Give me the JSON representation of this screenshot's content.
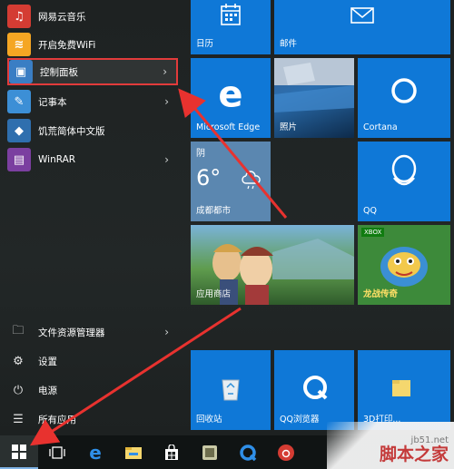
{
  "apps": [
    {
      "name": "网易云音乐",
      "icon": "netease-music-icon",
      "color": "#d43c33",
      "glyph": "♫"
    },
    {
      "name": "开启免费WiFi",
      "icon": "free-wifi-icon",
      "color": "#f5a623",
      "glyph": "≋"
    },
    {
      "name": "控制面板",
      "icon": "control-panel-icon",
      "color": "#3a7ec4",
      "glyph": "▣",
      "has_submenu": true,
      "highlighted": true
    },
    {
      "name": "记事本",
      "icon": "notepad-icon",
      "color": "#3c8fd6",
      "glyph": "✎",
      "has_submenu": true
    },
    {
      "name": "饥荒简体中文版",
      "icon": "dont-starve-icon",
      "color": "#2f6fae",
      "glyph": "◆"
    },
    {
      "name": "WinRAR",
      "icon": "winrar-icon",
      "color": "#7b3fa0",
      "glyph": "▤",
      "has_submenu": true
    }
  ],
  "system": [
    {
      "name": "文件资源管理器",
      "icon": "file-explorer-icon",
      "glyph": "🗀",
      "has_submenu": true
    },
    {
      "name": "设置",
      "icon": "settings-gear-icon",
      "glyph": "⚙"
    },
    {
      "name": "电源",
      "icon": "power-icon",
      "glyph": "⏻"
    },
    {
      "name": "所有应用",
      "icon": "all-apps-icon",
      "glyph": "☰"
    }
  ],
  "tiles": {
    "calendar": {
      "label": "日历",
      "icon": "calendar-icon"
    },
    "mail": {
      "label": "邮件",
      "icon": "mail-icon"
    },
    "edge": {
      "label": "Microsoft Edge",
      "icon": "edge-icon"
    },
    "photos": {
      "label": "照片",
      "icon": "photos-icon"
    },
    "cortana": {
      "label": "Cortana",
      "icon": "cortana-icon"
    },
    "weather": {
      "condition": "阴",
      "temp": "6°",
      "city": "成都都市",
      "icon": "weather-cloud-icon"
    },
    "qq": {
      "label": "QQ",
      "icon": "qq-icon"
    },
    "store": {
      "label": "应用商店",
      "icon": "store-icon"
    },
    "xbox": {
      "badge": "XBOX",
      "label": "龙战传奇",
      "icon": "xbox-icon"
    },
    "recycle": {
      "label": "回收站",
      "icon": "recycle-bin-icon"
    },
    "qqbrowser": {
      "label": "QQ浏览器",
      "icon": "qq-browser-icon"
    },
    "folder": {
      "label": "3D打印...",
      "icon": "folder-icon"
    }
  },
  "taskbar": [
    {
      "name": "start-button",
      "icon": "windows-logo-icon"
    },
    {
      "name": "task-view-button",
      "icon": "task-view-icon"
    },
    {
      "name": "edge-taskbar-button",
      "icon": "edge-icon"
    },
    {
      "name": "file-explorer-taskbar-button",
      "icon": "folder-icon"
    },
    {
      "name": "store-taskbar-button",
      "icon": "store-icon"
    },
    {
      "name": "app-taskbar-button",
      "icon": "game-icon"
    },
    {
      "name": "qq-browser-taskbar-button",
      "icon": "qq-browser-icon"
    },
    {
      "name": "netease-taskbar-button",
      "icon": "netease-music-icon"
    }
  ],
  "watermark": {
    "url": "jb51.net",
    "name": "脚本之家"
  },
  "colors": {
    "tile_blue": "#0f78d7",
    "highlight_border": "#e23b3b",
    "arrow_red": "#e8322f"
  }
}
